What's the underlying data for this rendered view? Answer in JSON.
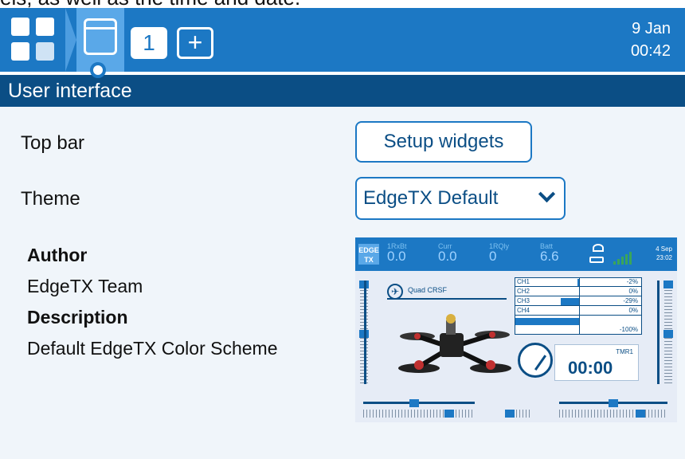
{
  "caption_text": "els, as well as the time and date.",
  "topbar": {
    "page_number": "1",
    "add_label": "+",
    "date": "9 Jan",
    "time": "00:42"
  },
  "section_title": "User interface",
  "settings": {
    "topbar_label": "Top bar",
    "setup_widgets_label": "Setup widgets",
    "theme_label": "Theme",
    "theme_value": "EdgeTX Default"
  },
  "theme_info": {
    "author_heading": "Author",
    "author_value": "EdgeTX Team",
    "description_heading": "Description",
    "description_value": "Default EdgeTX Color Scheme"
  },
  "preview": {
    "logo_text": "EDGE TX",
    "telemetry": [
      {
        "name": "1RxBt",
        "value": "0.0"
      },
      {
        "name": "Curr",
        "value": "0.0"
      },
      {
        "name": "1RQly",
        "value": "0"
      },
      {
        "name": "Batt",
        "value": "6.6"
      }
    ],
    "date": "4 Sep",
    "time": "23:02",
    "model_name": "Quad CRSF",
    "channels": [
      {
        "name": "CH1",
        "value": "-2%",
        "fraction": -0.02
      },
      {
        "name": "CH2",
        "value": "0%",
        "fraction": 0
      },
      {
        "name": "CH3",
        "value": "-29%",
        "fraction": -0.29
      },
      {
        "name": "CH4",
        "value": "0%",
        "fraction": 0
      },
      {
        "name": "",
        "value": "-100%",
        "fraction": -1.0
      }
    ],
    "timer_label": "TMR1",
    "timer_value": "00:00"
  },
  "colors": {
    "primary": "#1c78c4",
    "dark": "#0b4e85",
    "background": "#f0f5fa"
  }
}
